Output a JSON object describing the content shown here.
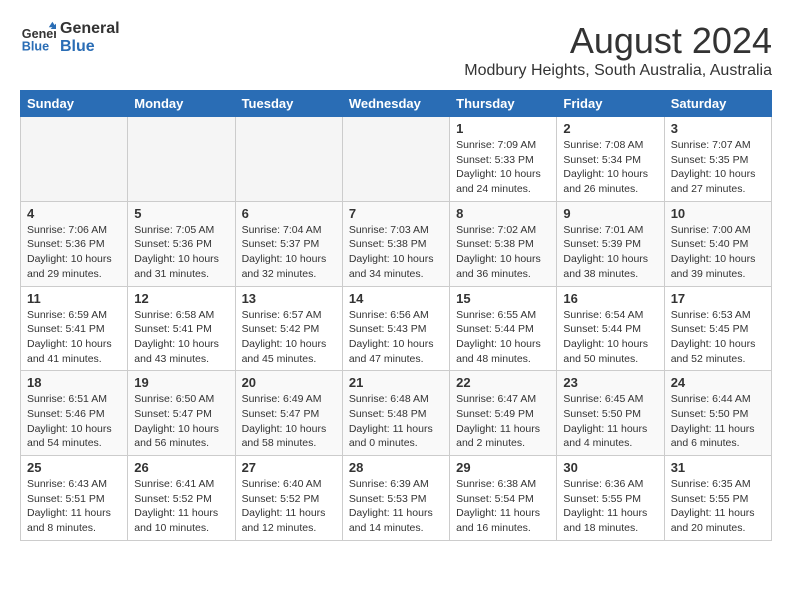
{
  "header": {
    "logo_line1": "General",
    "logo_line2": "Blue",
    "month_year": "August 2024",
    "location": "Modbury Heights, South Australia, Australia"
  },
  "days_of_week": [
    "Sunday",
    "Monday",
    "Tuesday",
    "Wednesday",
    "Thursday",
    "Friday",
    "Saturday"
  ],
  "weeks": [
    [
      {
        "day": "",
        "info": ""
      },
      {
        "day": "",
        "info": ""
      },
      {
        "day": "",
        "info": ""
      },
      {
        "day": "",
        "info": ""
      },
      {
        "day": "1",
        "info": "Sunrise: 7:09 AM\nSunset: 5:33 PM\nDaylight: 10 hours\nand 24 minutes."
      },
      {
        "day": "2",
        "info": "Sunrise: 7:08 AM\nSunset: 5:34 PM\nDaylight: 10 hours\nand 26 minutes."
      },
      {
        "day": "3",
        "info": "Sunrise: 7:07 AM\nSunset: 5:35 PM\nDaylight: 10 hours\nand 27 minutes."
      }
    ],
    [
      {
        "day": "4",
        "info": "Sunrise: 7:06 AM\nSunset: 5:36 PM\nDaylight: 10 hours\nand 29 minutes."
      },
      {
        "day": "5",
        "info": "Sunrise: 7:05 AM\nSunset: 5:36 PM\nDaylight: 10 hours\nand 31 minutes."
      },
      {
        "day": "6",
        "info": "Sunrise: 7:04 AM\nSunset: 5:37 PM\nDaylight: 10 hours\nand 32 minutes."
      },
      {
        "day": "7",
        "info": "Sunrise: 7:03 AM\nSunset: 5:38 PM\nDaylight: 10 hours\nand 34 minutes."
      },
      {
        "day": "8",
        "info": "Sunrise: 7:02 AM\nSunset: 5:38 PM\nDaylight: 10 hours\nand 36 minutes."
      },
      {
        "day": "9",
        "info": "Sunrise: 7:01 AM\nSunset: 5:39 PM\nDaylight: 10 hours\nand 38 minutes."
      },
      {
        "day": "10",
        "info": "Sunrise: 7:00 AM\nSunset: 5:40 PM\nDaylight: 10 hours\nand 39 minutes."
      }
    ],
    [
      {
        "day": "11",
        "info": "Sunrise: 6:59 AM\nSunset: 5:41 PM\nDaylight: 10 hours\nand 41 minutes."
      },
      {
        "day": "12",
        "info": "Sunrise: 6:58 AM\nSunset: 5:41 PM\nDaylight: 10 hours\nand 43 minutes."
      },
      {
        "day": "13",
        "info": "Sunrise: 6:57 AM\nSunset: 5:42 PM\nDaylight: 10 hours\nand 45 minutes."
      },
      {
        "day": "14",
        "info": "Sunrise: 6:56 AM\nSunset: 5:43 PM\nDaylight: 10 hours\nand 47 minutes."
      },
      {
        "day": "15",
        "info": "Sunrise: 6:55 AM\nSunset: 5:44 PM\nDaylight: 10 hours\nand 48 minutes."
      },
      {
        "day": "16",
        "info": "Sunrise: 6:54 AM\nSunset: 5:44 PM\nDaylight: 10 hours\nand 50 minutes."
      },
      {
        "day": "17",
        "info": "Sunrise: 6:53 AM\nSunset: 5:45 PM\nDaylight: 10 hours\nand 52 minutes."
      }
    ],
    [
      {
        "day": "18",
        "info": "Sunrise: 6:51 AM\nSunset: 5:46 PM\nDaylight: 10 hours\nand 54 minutes."
      },
      {
        "day": "19",
        "info": "Sunrise: 6:50 AM\nSunset: 5:47 PM\nDaylight: 10 hours\nand 56 minutes."
      },
      {
        "day": "20",
        "info": "Sunrise: 6:49 AM\nSunset: 5:47 PM\nDaylight: 10 hours\nand 58 minutes."
      },
      {
        "day": "21",
        "info": "Sunrise: 6:48 AM\nSunset: 5:48 PM\nDaylight: 11 hours\nand 0 minutes."
      },
      {
        "day": "22",
        "info": "Sunrise: 6:47 AM\nSunset: 5:49 PM\nDaylight: 11 hours\nand 2 minutes."
      },
      {
        "day": "23",
        "info": "Sunrise: 6:45 AM\nSunset: 5:50 PM\nDaylight: 11 hours\nand 4 minutes."
      },
      {
        "day": "24",
        "info": "Sunrise: 6:44 AM\nSunset: 5:50 PM\nDaylight: 11 hours\nand 6 minutes."
      }
    ],
    [
      {
        "day": "25",
        "info": "Sunrise: 6:43 AM\nSunset: 5:51 PM\nDaylight: 11 hours\nand 8 minutes."
      },
      {
        "day": "26",
        "info": "Sunrise: 6:41 AM\nSunset: 5:52 PM\nDaylight: 11 hours\nand 10 minutes."
      },
      {
        "day": "27",
        "info": "Sunrise: 6:40 AM\nSunset: 5:52 PM\nDaylight: 11 hours\nand 12 minutes."
      },
      {
        "day": "28",
        "info": "Sunrise: 6:39 AM\nSunset: 5:53 PM\nDaylight: 11 hours\nand 14 minutes."
      },
      {
        "day": "29",
        "info": "Sunrise: 6:38 AM\nSunset: 5:54 PM\nDaylight: 11 hours\nand 16 minutes."
      },
      {
        "day": "30",
        "info": "Sunrise: 6:36 AM\nSunset: 5:55 PM\nDaylight: 11 hours\nand 18 minutes."
      },
      {
        "day": "31",
        "info": "Sunrise: 6:35 AM\nSunset: 5:55 PM\nDaylight: 11 hours\nand 20 minutes."
      }
    ]
  ]
}
